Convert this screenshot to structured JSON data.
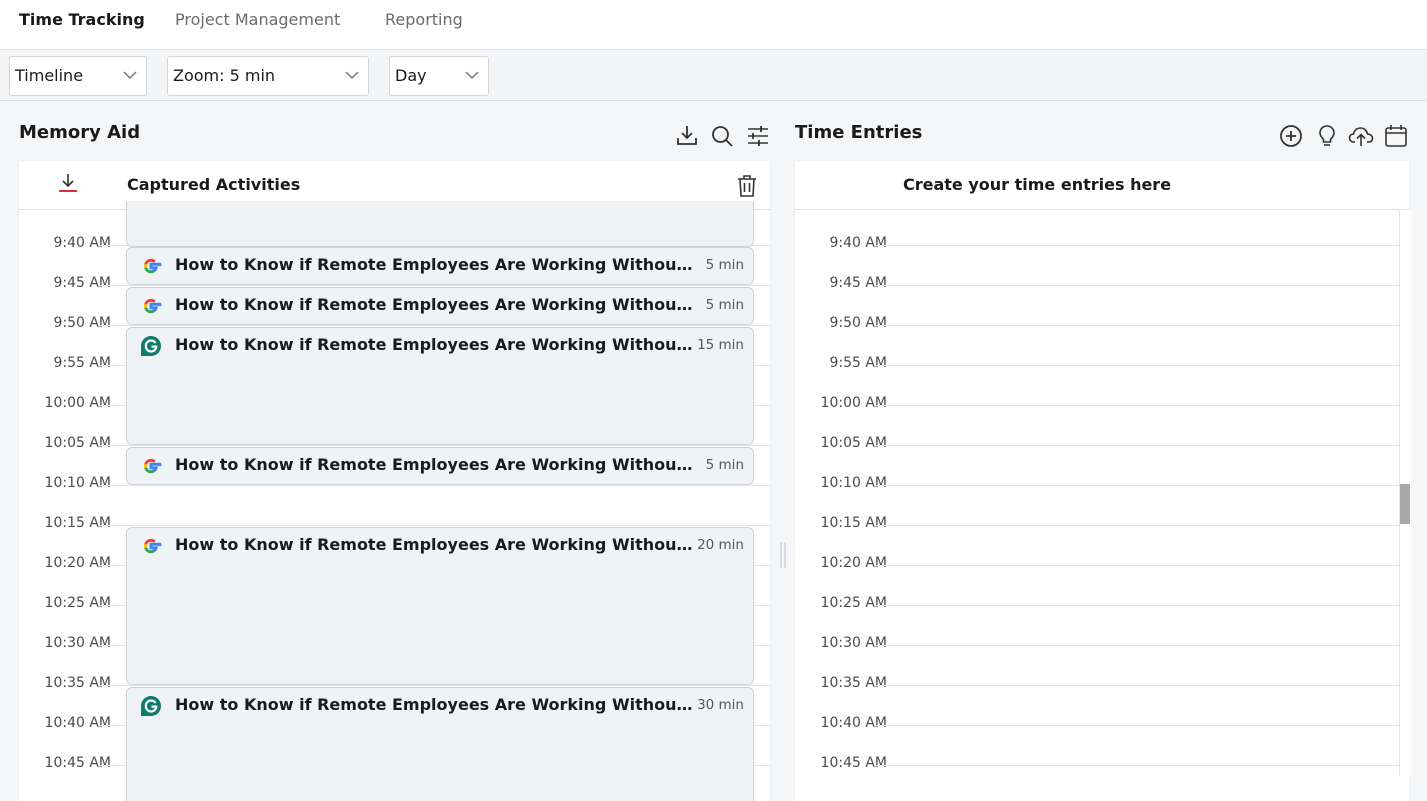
{
  "nav": {
    "tabs": [
      {
        "label": "Time Tracking",
        "active": true
      },
      {
        "label": "Project Management",
        "active": false
      },
      {
        "label": "Reporting",
        "active": false
      }
    ]
  },
  "toolbar": {
    "view_select": "Timeline",
    "zoom_select": "Zoom: 5 min",
    "range_select": "Day"
  },
  "memory_aid": {
    "title": "Memory Aid",
    "header_icons": [
      "download-icon",
      "search-icon",
      "filter-settings-icon"
    ],
    "card_title": "Captured Activities",
    "time_slots": [
      "9:40 AM",
      "9:45 AM",
      "9:50 AM",
      "9:55 AM",
      "10:00 AM",
      "10:05 AM",
      "10:10 AM",
      "10:15 AM",
      "10:20 AM",
      "10:25 AM",
      "10:30 AM",
      "10:35 AM",
      "10:40 AM",
      "10:45 AM"
    ],
    "activities": [
      {
        "app": "google-chrome-icon",
        "title": "How to Know if Remote Employees Are Working Without Spying",
        "duration": "5 min"
      },
      {
        "app": "google-chrome-icon",
        "title": "How to Know if Remote Employees Are Working Without Spying",
        "duration": "5 min"
      },
      {
        "app": "grammarly-icon",
        "title": "How to Know if Remote Employees Are Working Without Spying",
        "duration": "15 min"
      },
      {
        "app": "google-chrome-icon",
        "title": "How to Know if Remote Employees Are Working Without Spying",
        "duration": "5 min"
      },
      {
        "app": "google-chrome-icon",
        "title": "How to Know if Remote Employees Are Working Without Spying",
        "duration": "20 min"
      },
      {
        "app": "grammarly-icon",
        "title": "How to Know if Remote Employees Are Working Without Spying",
        "duration": "30 min"
      }
    ]
  },
  "time_entries": {
    "title": "Time Entries",
    "header_icons": [
      "add-circle-icon",
      "lightbulb-icon",
      "cloud-upload-icon",
      "calendar-icon"
    ],
    "card_title": "Create your time entries here",
    "time_slots": [
      "9:40 AM",
      "9:45 AM",
      "9:50 AM",
      "9:55 AM",
      "10:00 AM",
      "10:05 AM",
      "10:10 AM",
      "10:15 AM",
      "10:20 AM",
      "10:25 AM",
      "10:30 AM",
      "10:35 AM",
      "10:40 AM",
      "10:45 AM"
    ]
  },
  "colors": {
    "accent_red": "#d9343b",
    "grammarly_green": "#0f7b6c",
    "activity_bg": "#f0f3f6"
  }
}
